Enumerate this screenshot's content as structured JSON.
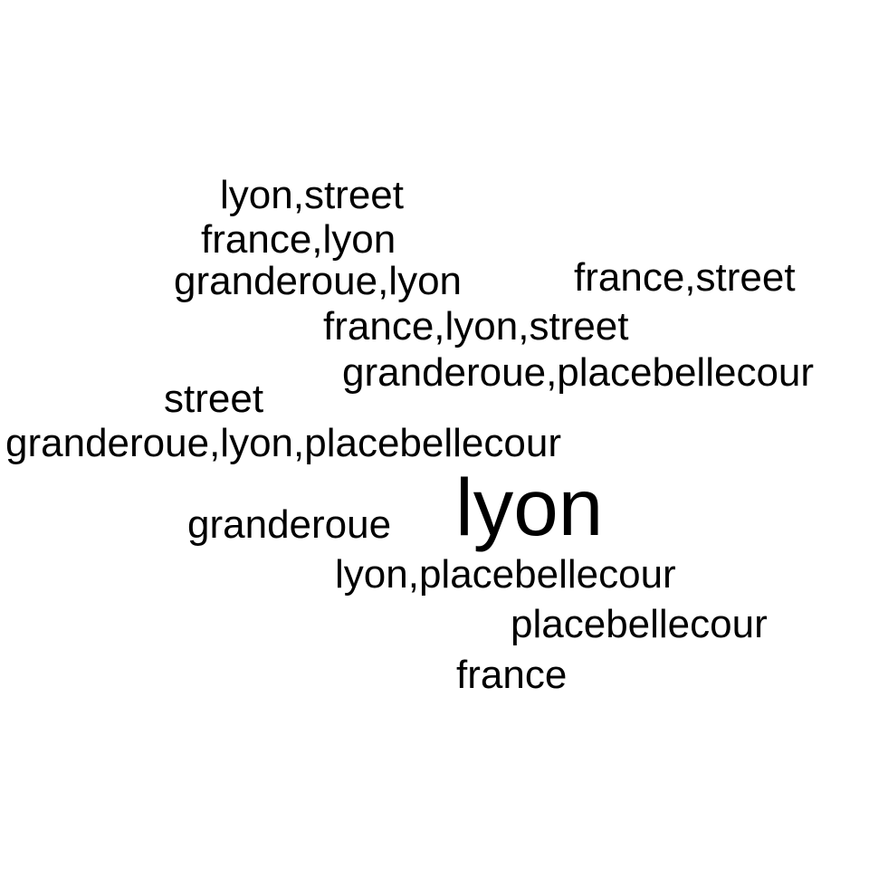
{
  "cloud": {
    "text_color": "#000000",
    "background": "#ffffff",
    "words": {
      "lyon_street": "lyon,street",
      "france_lyon": "france,lyon",
      "granderoue_lyon": "granderoue,lyon",
      "france_street": "france,street",
      "france_lyon_street": "france,lyon,street",
      "granderoue_placebellecour": "granderoue,placebellecour",
      "street": "street",
      "granderoue_lyon_placebellecour": "granderoue,lyon,placebellecour",
      "lyon": "lyon",
      "granderoue": "granderoue",
      "lyon_placebellecour": "lyon,placebellecour",
      "placebellecour": "placebellecour",
      "france": "france"
    }
  }
}
